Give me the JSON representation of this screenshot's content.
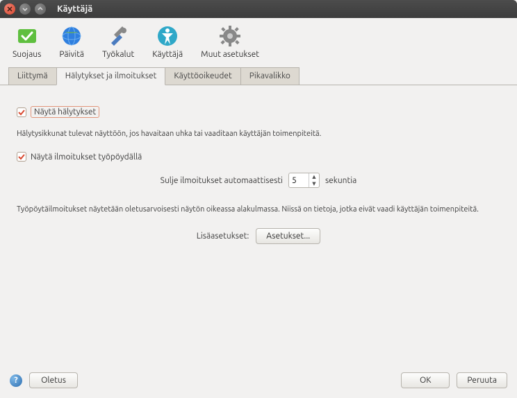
{
  "window": {
    "title": "Käyttäjä"
  },
  "toolbar": {
    "protect": "Suojaus",
    "update": "Päivitä",
    "tools": "Työkalut",
    "user": "Käyttäjä",
    "other": "Muut asetukset"
  },
  "tabs": {
    "interface": "Liittymä",
    "alerts": "Hälytykset ja ilmoitukset",
    "rights": "Käyttöoikeudet",
    "quickmenu": "Pikavalikko"
  },
  "content": {
    "show_alerts_label": "Näytä hälytykset",
    "alerts_desc": "Hälytysikkunat tulevat näyttöön, jos havaitaan uhka tai vaaditaan käyttäjän toimenpiteitä.",
    "show_desktop_label": "Näytä ilmoitukset työpöydällä",
    "auto_close_label": "Sulje ilmoitukset automaattisesti",
    "auto_close_value": "5",
    "seconds_label": "sekuntia",
    "desktop_desc": "Työpöytäilmoitukset näytetään oletusarvoisesti näytön oikeassa alakulmassa. Niissä on tietoja, jotka eivät vaadi käyttäjän toimenpiteitä.",
    "advanced_label": "Lisäasetukset:",
    "settings_btn": "Asetukset..."
  },
  "footer": {
    "default": "Oletus",
    "ok": "OK",
    "cancel": "Peruuta"
  }
}
